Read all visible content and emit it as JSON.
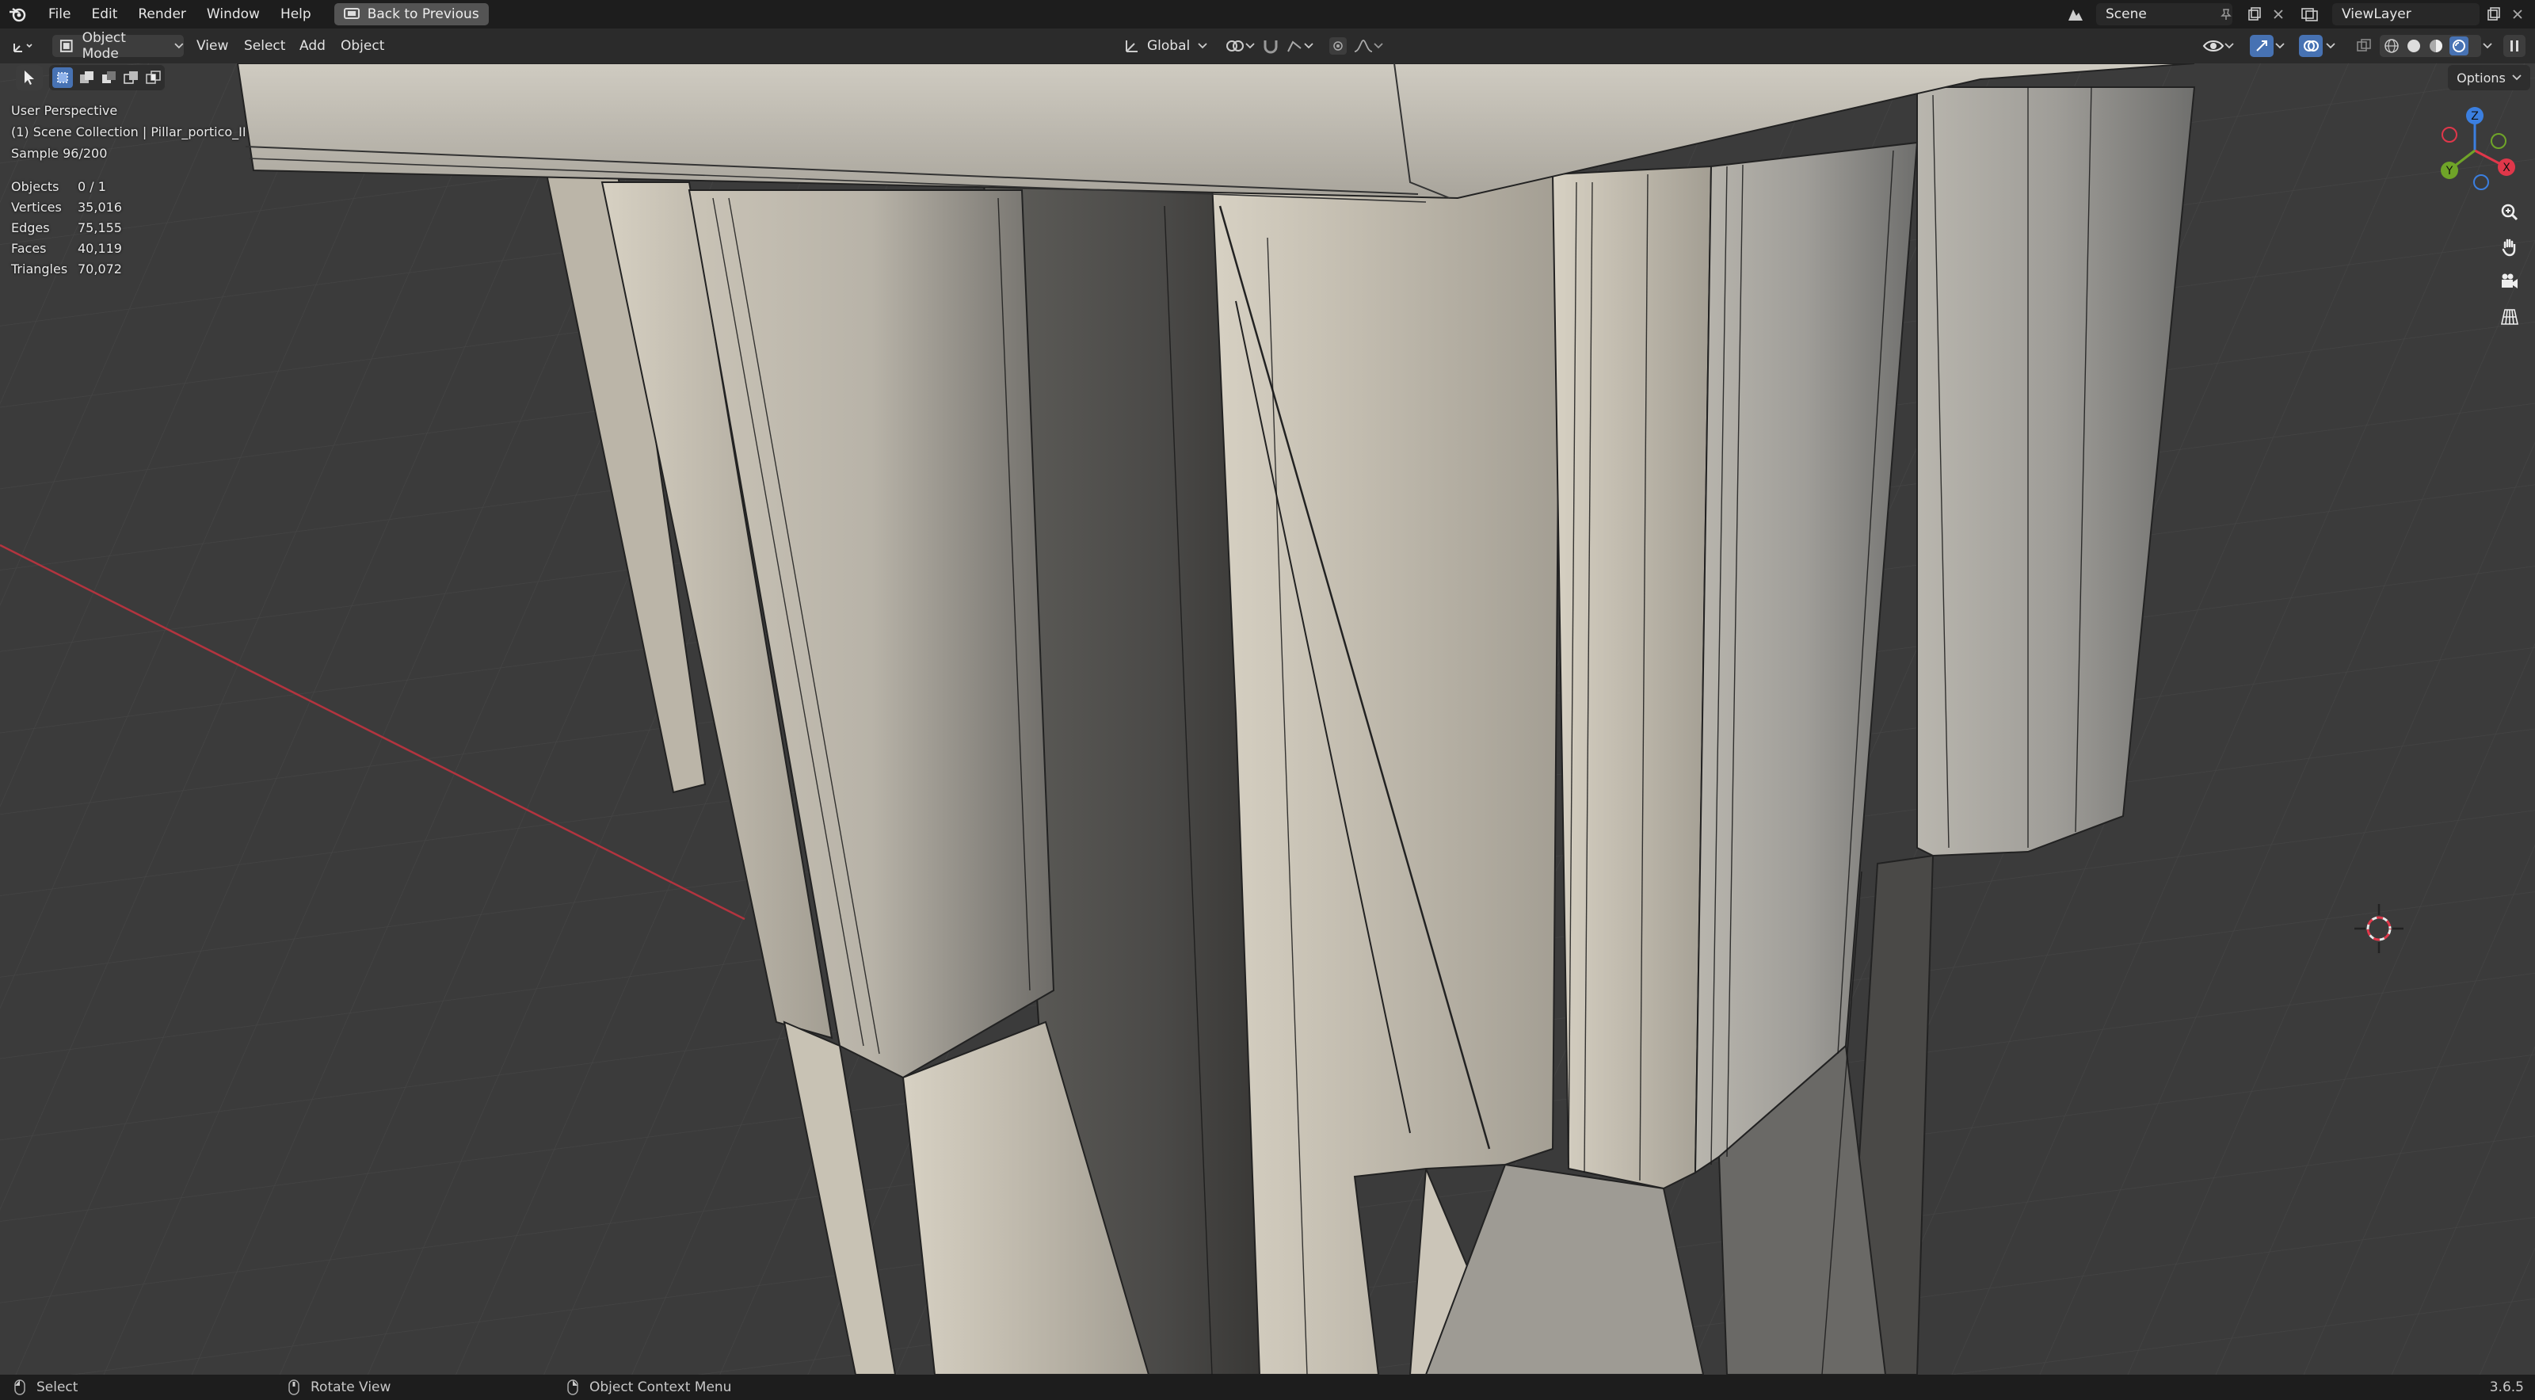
{
  "menu": {
    "items": [
      "File",
      "Edit",
      "Render",
      "Window",
      "Help"
    ],
    "back_button": "Back to Previous"
  },
  "top_right": {
    "scene": "Scene",
    "view_layer": "ViewLayer"
  },
  "header": {
    "mode": "Object Mode",
    "menus": [
      "View",
      "Select",
      "Add",
      "Object"
    ],
    "transform_orientation": "Global",
    "options": "Options"
  },
  "viewport": {
    "perspective": "User Perspective",
    "collection": "(1) Scene Collection | Pillar_portico_II",
    "sample": "Sample 96/200",
    "stats": [
      {
        "label": "Objects",
        "value": "0 / 1"
      },
      {
        "label": "Vertices",
        "value": "35,016"
      },
      {
        "label": "Edges",
        "value": "75,155"
      },
      {
        "label": "Faces",
        "value": "40,119"
      },
      {
        "label": "Triangles",
        "value": "70,072"
      }
    ],
    "gizmo": {
      "x": "X",
      "y": "Y",
      "z": "Z"
    }
  },
  "status": {
    "select": "Select",
    "rotate": "Rotate View",
    "context_menu": "Object Context Menu",
    "version": "3.6.5"
  },
  "colors": {
    "axis_x": "#e0374a",
    "axis_y": "#6fa428",
    "axis_z": "#3b7fe0",
    "active_blue": "#4772b3"
  }
}
